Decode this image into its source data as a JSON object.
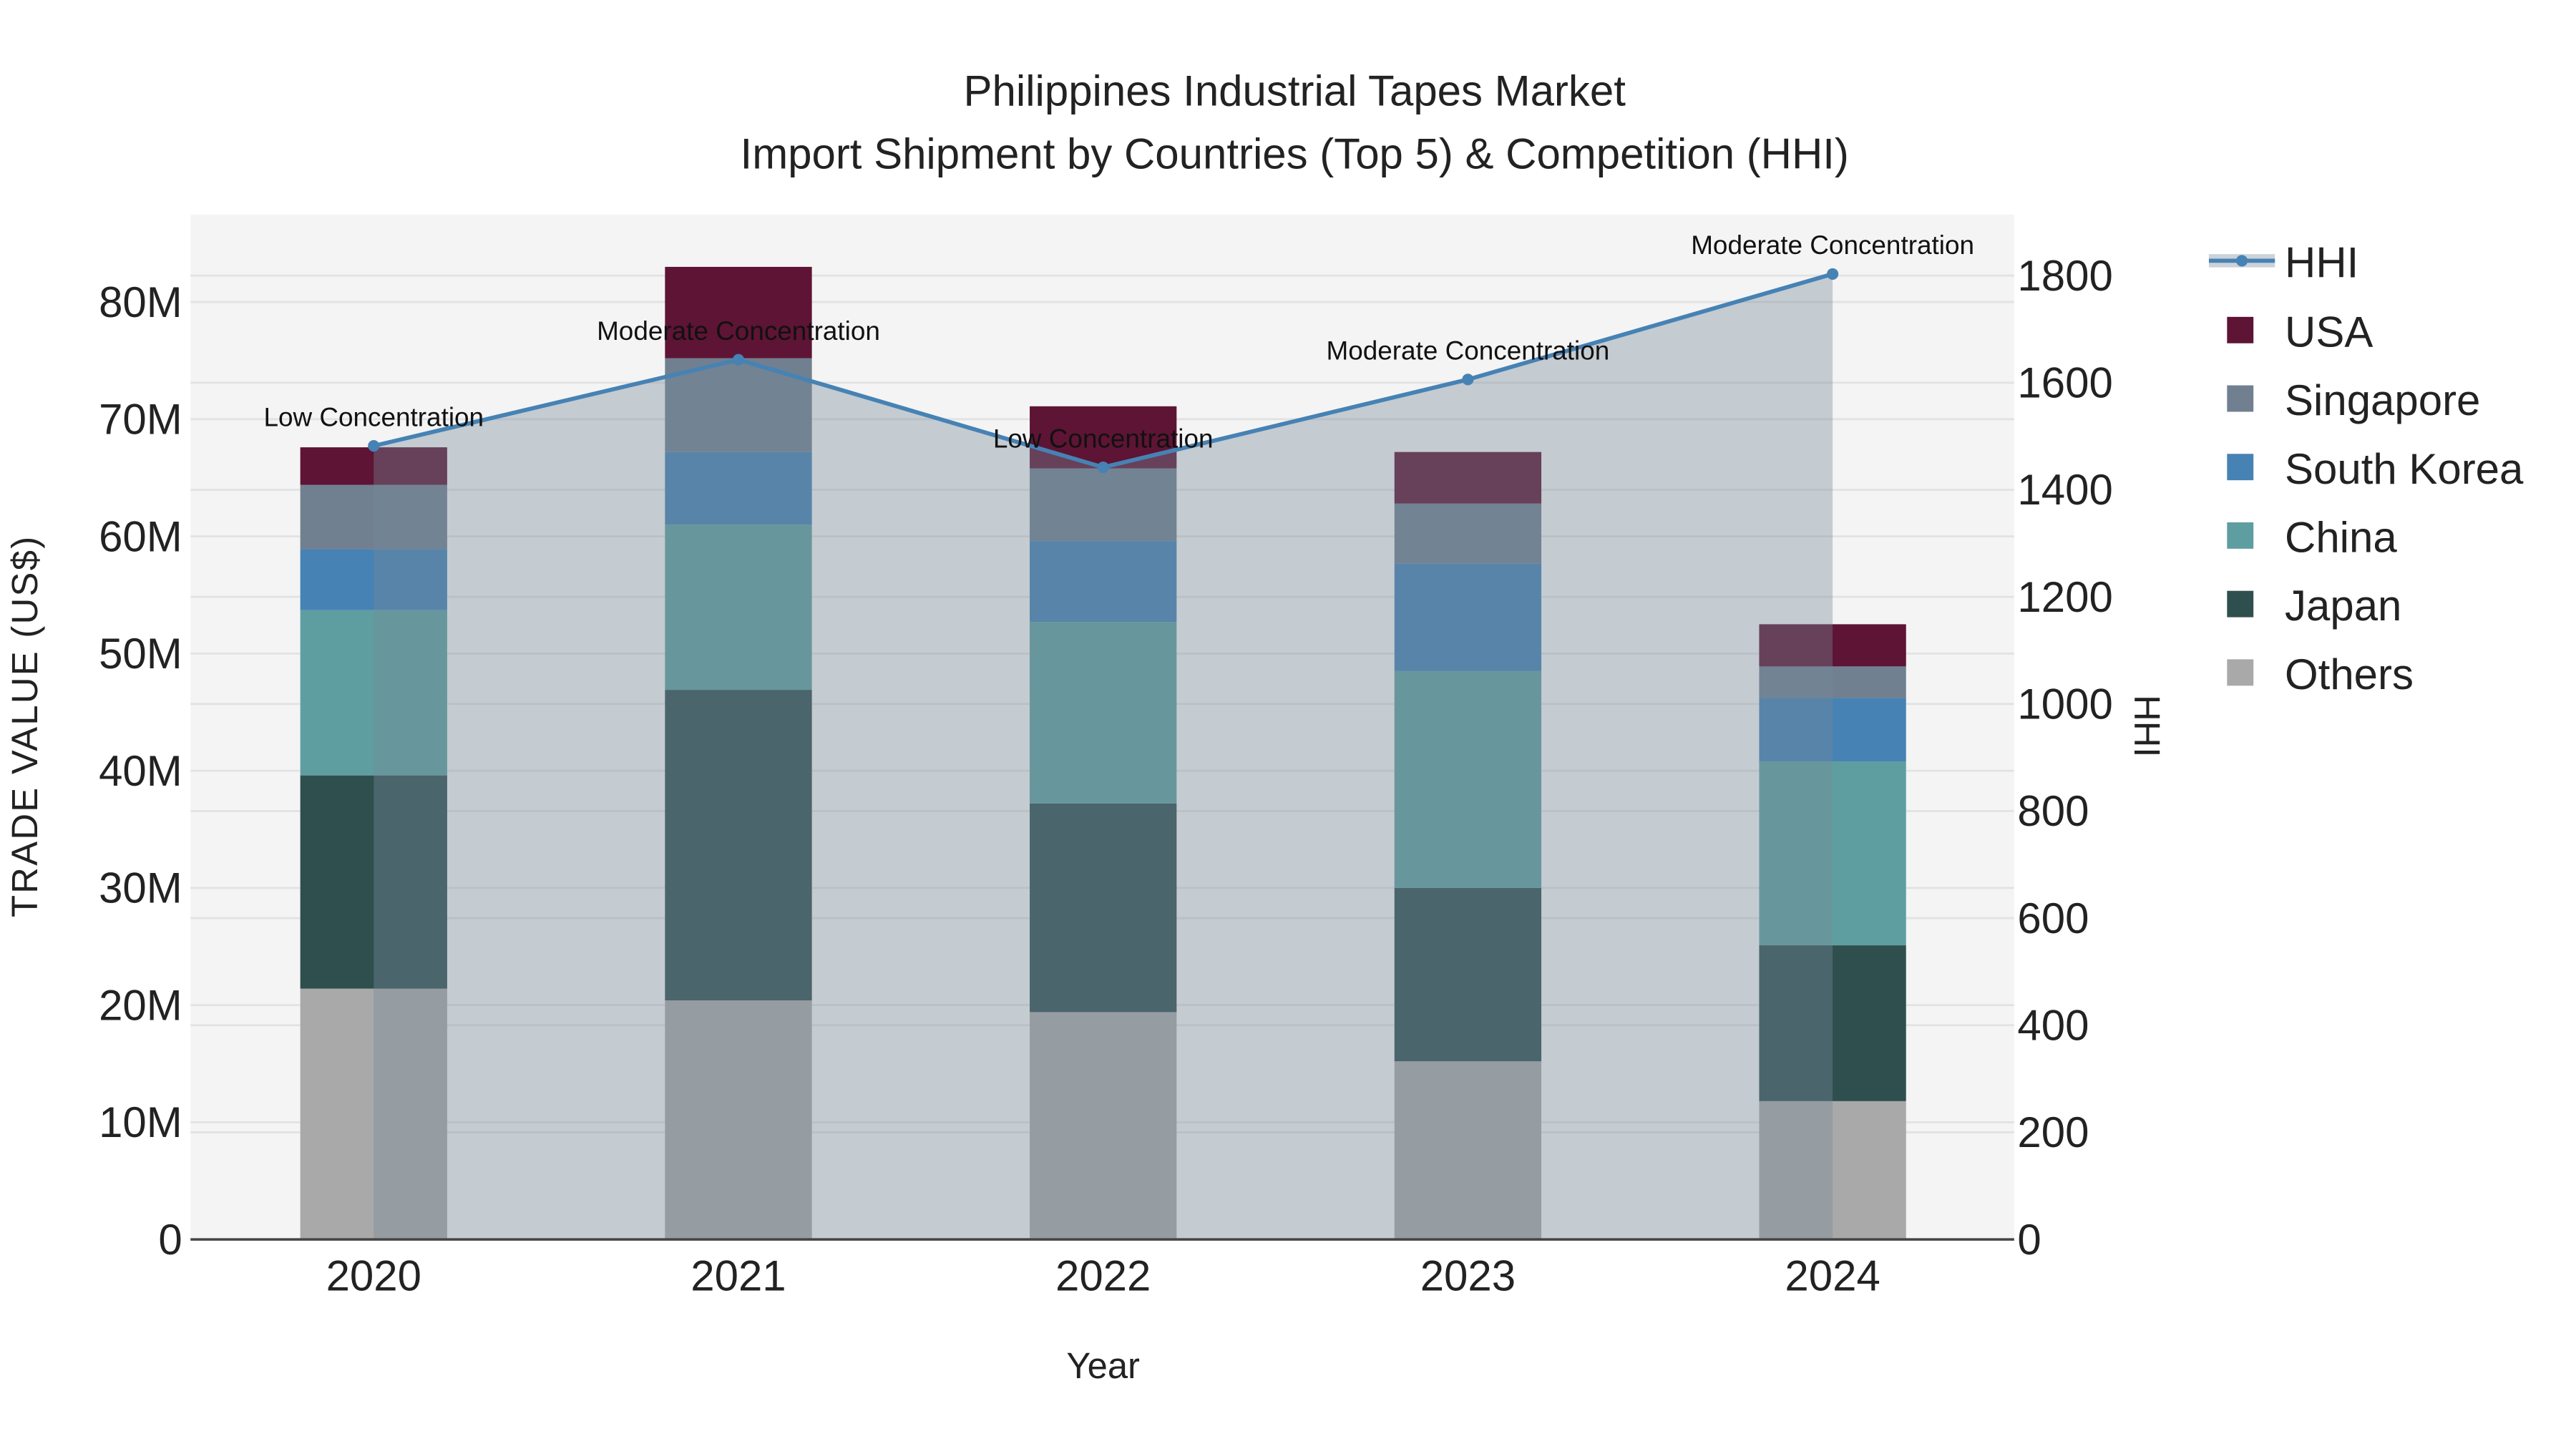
{
  "chart_data": {
    "type": "bar",
    "stacked": true,
    "title": "Philippines Industrial Tapes Market",
    "subtitle": "Import Shipment by Countries (Top 5) & Competition (HHI)",
    "xlabel": "Year",
    "ylabel": "TRADE VALUE (US$)",
    "y2label": "HHI",
    "categories": [
      "2020",
      "2021",
      "2022",
      "2023",
      "2024"
    ],
    "ylim": [
      0,
      87
    ],
    "yticks": [
      0,
      10,
      20,
      30,
      40,
      50,
      60,
      70,
      80
    ],
    "ytick_labels": [
      "0",
      "10M",
      "20M",
      "30M",
      "40M",
      "50M",
      "60M",
      "70M",
      "80M"
    ],
    "y2lim": [
      0,
      1910
    ],
    "y2ticks": [
      0,
      200,
      400,
      600,
      800,
      1000,
      1200,
      1400,
      1600,
      1800
    ],
    "y2tick_labels": [
      "0",
      "200",
      "400",
      "600",
      "800",
      "1000",
      "1200",
      "1400",
      "1600",
      "1800"
    ],
    "units": "US$ millions",
    "series": [
      {
        "name": "Others",
        "color": "#a9a9a9",
        "values": [
          21.4,
          20.4,
          19.4,
          15.2,
          11.8
        ]
      },
      {
        "name": "Japan",
        "color": "#2f4f4f",
        "values": [
          18.2,
          26.5,
          17.8,
          14.8,
          13.3
        ]
      },
      {
        "name": "China",
        "color": "#5f9ea0",
        "values": [
          14.1,
          14.1,
          15.5,
          18.5,
          15.7
        ]
      },
      {
        "name": "South Korea",
        "color": "#4682b4",
        "values": [
          5.2,
          6.2,
          6.9,
          9.2,
          5.4
        ]
      },
      {
        "name": "Singapore",
        "color": "#708090",
        "values": [
          5.5,
          8.0,
          6.2,
          5.1,
          2.7
        ]
      },
      {
        "name": "USA",
        "color": "#5e1434",
        "values": [
          3.2,
          7.8,
          5.3,
          4.4,
          3.6
        ]
      }
    ],
    "line": {
      "name": "HHI",
      "axis": "right",
      "color": "#4682b4",
      "values": [
        1482,
        1643,
        1442,
        1606,
        1803
      ],
      "annotations": [
        "Low Concentration",
        "Moderate Concentration",
        "Low Concentration",
        "Moderate Concentration",
        "Moderate Concentration"
      ]
    },
    "legend": {
      "position": "right",
      "entries": [
        "HHI",
        "USA",
        "Singapore",
        "South Korea",
        "China",
        "Japan",
        "Others"
      ]
    },
    "grid": true
  }
}
